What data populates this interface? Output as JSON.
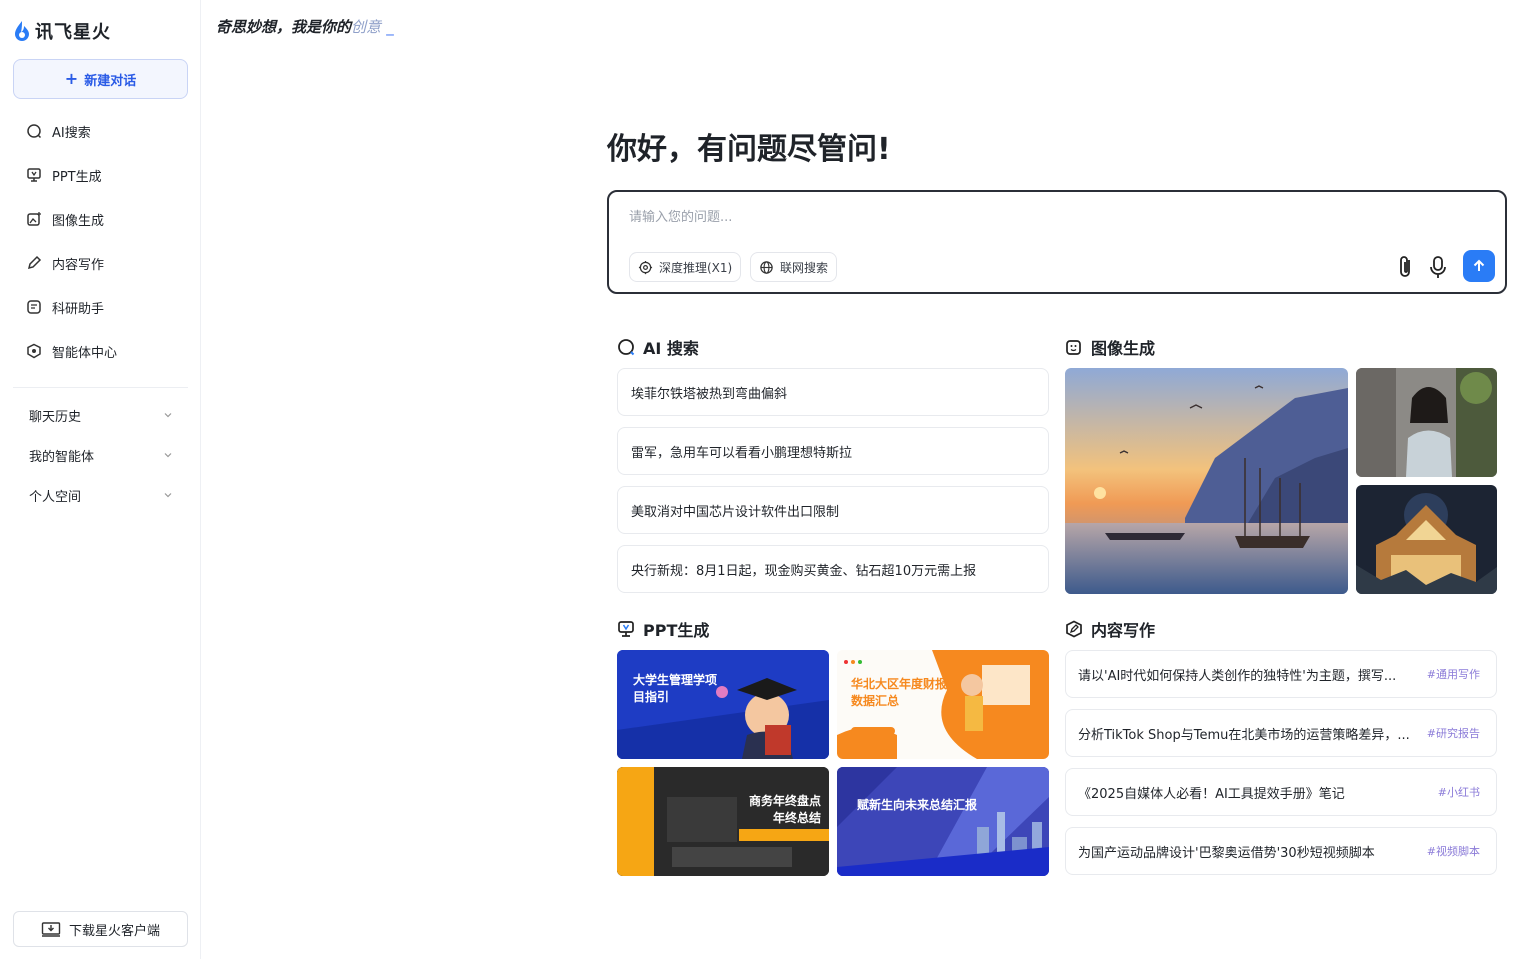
{
  "brand": {
    "name": "讯飞星火"
  },
  "tagline": {
    "prefix": "奇思妙想，我是你的",
    "accent": "创意",
    "cursor": "_"
  },
  "sidebar": {
    "new_chat": "新建对话",
    "items": [
      {
        "label": "AI搜索",
        "icon": "ai-search-icon"
      },
      {
        "label": "PPT生成",
        "icon": "ppt-icon"
      },
      {
        "label": "图像生成",
        "icon": "image-gen-icon"
      },
      {
        "label": "内容写作",
        "icon": "writing-icon"
      },
      {
        "label": "科研助手",
        "icon": "research-icon"
      },
      {
        "label": "智能体中心",
        "icon": "agent-center-icon"
      }
    ],
    "groups": [
      {
        "label": "聊天历史"
      },
      {
        "label": "我的智能体"
      },
      {
        "label": "个人空间"
      }
    ],
    "download": "下载星火客户端"
  },
  "main": {
    "greeting": "你好，有问题尽管问!",
    "input_placeholder": "请输入您的问题...",
    "chips": {
      "deep": "深度推理(X1)",
      "web": "联网搜索"
    }
  },
  "sections": {
    "ai_search": {
      "title": "AI 搜索",
      "items": [
        "埃菲尔铁塔被热到弯曲偏斜",
        "雷军，急用车可以看看小鹏理想特斯拉",
        "美取消对中国芯片设计软件出口限制",
        "央行新规：8月1日起，现金购买黄金、钻石超10万元需上报"
      ]
    },
    "image_gen": {
      "title": "图像生成"
    },
    "ppt": {
      "title": "PPT生成",
      "cards": [
        {
          "title": "大学生管理学项目指引",
          "line1": "大学生管理学项",
          "line2": "目指引"
        },
        {
          "title": "华北大区年度财报数据汇总",
          "line1": "华北大区年度财报",
          "line2": "数据汇总"
        },
        {
          "title": "商务年终盘点年终总结",
          "line1": "商务年终盘点",
          "line2": "年终总结"
        },
        {
          "title": "赋新生向未来总结汇报",
          "line1": "赋新生向未来总结汇报",
          "line2": ""
        }
      ]
    },
    "writing": {
      "title": "内容写作",
      "items": [
        {
          "text": "请以'AI时代如何保持人类创作的独特性'为主题，撰写...",
          "tag": "#通用写作"
        },
        {
          "text": "分析TikTok Shop与Temu在北美市场的运营策略差异，...",
          "tag": "#研究报告"
        },
        {
          "text": "《2025自媒体人必看！AI工具提效手册》笔记",
          "tag": "#小红书"
        },
        {
          "text": "为国产运动品牌设计'巴黎奥运借势'30秒短视频脚本",
          "tag": "#视频脚本"
        }
      ]
    }
  },
  "colors": {
    "accent": "#2a7cf6",
    "tag": "#8b7bd8"
  }
}
